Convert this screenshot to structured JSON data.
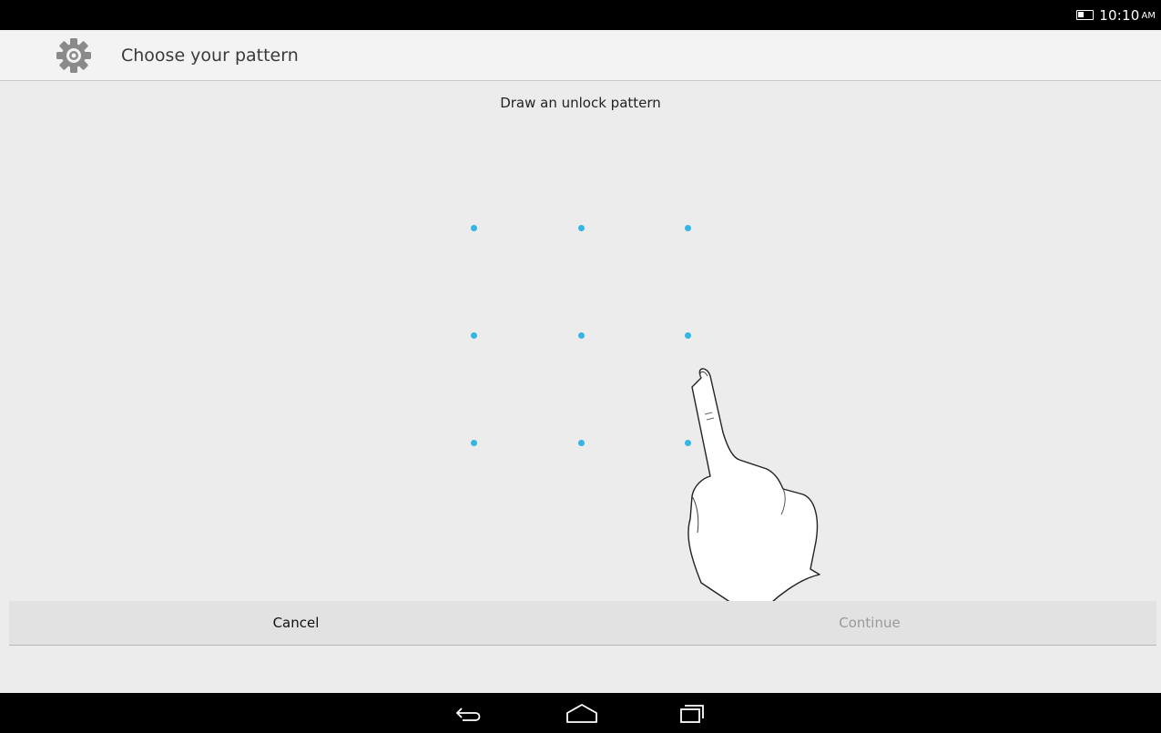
{
  "status_bar": {
    "time": "10:10",
    "ampm": "AM",
    "battery_icon": "battery-icon"
  },
  "action_bar": {
    "title": "Choose your pattern",
    "icon": "settings-gear-icon"
  },
  "content": {
    "header": "Draw an unlock pattern"
  },
  "pattern": {
    "rows": 3,
    "columns": 3,
    "dot_color": "#33b5e5"
  },
  "footer": {
    "cancel_label": "Cancel",
    "continue_label": "Continue",
    "continue_enabled": false
  },
  "nav_bar": {
    "back_icon": "back-icon",
    "home_icon": "home-icon",
    "recents_icon": "recent-apps-icon"
  }
}
